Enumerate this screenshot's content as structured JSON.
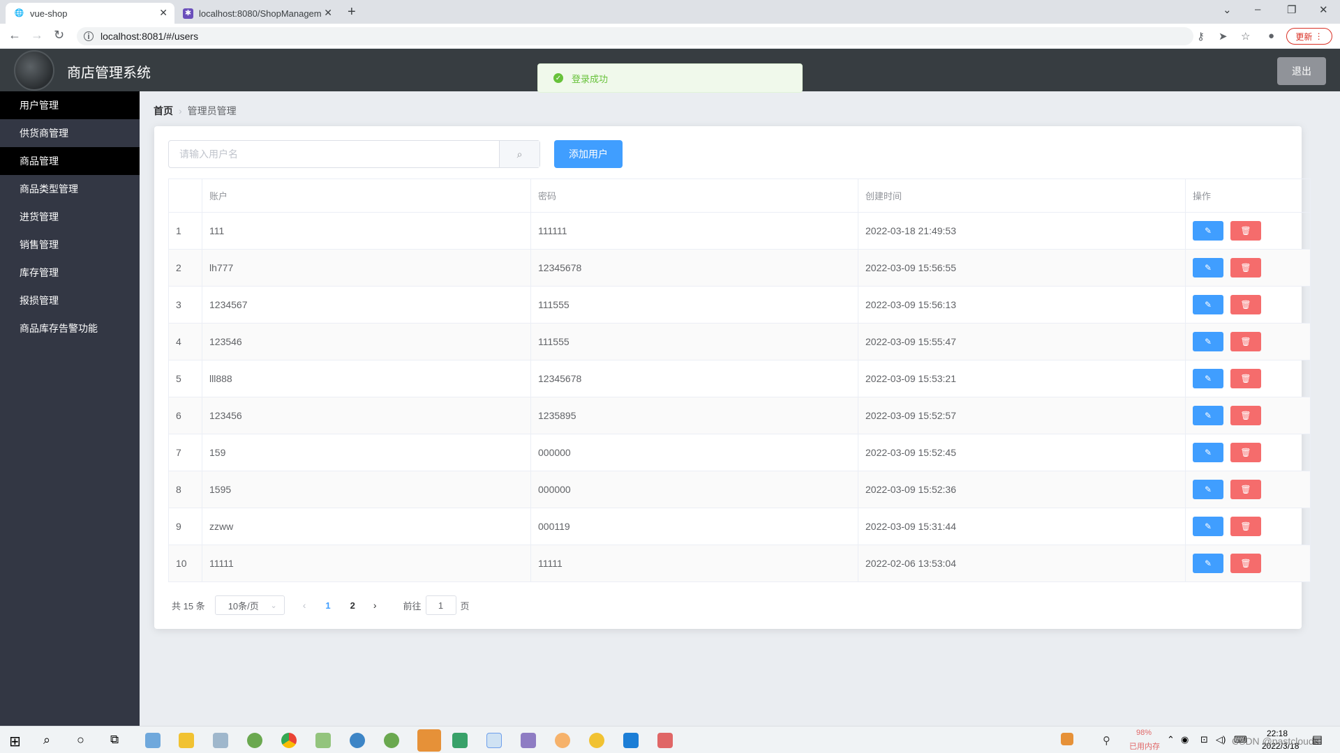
{
  "browser": {
    "tabs": [
      {
        "title": "vue-shop",
        "active": true
      },
      {
        "title": "localhost:8080/ShopManagem",
        "active": false
      }
    ],
    "url": "localhost:8081/#/users",
    "update_label": "更新"
  },
  "header": {
    "title": "商店管理系统",
    "logout_label": "退出"
  },
  "toast": {
    "message": "登录成功"
  },
  "sidebar": {
    "items": [
      {
        "label": "用户管理",
        "active": true
      },
      {
        "label": "供货商管理"
      },
      {
        "label": "商品管理",
        "hovered": true
      },
      {
        "label": "商品类型管理"
      },
      {
        "label": "进货管理"
      },
      {
        "label": "销售管理"
      },
      {
        "label": "库存管理"
      },
      {
        "label": "报损管理"
      },
      {
        "label": "商品库存告警功能"
      }
    ]
  },
  "breadcrumb": {
    "home": "首页",
    "current": "管理员管理"
  },
  "search": {
    "placeholder": "请输入用户名",
    "value": ""
  },
  "add_button_label": "添加用户",
  "table": {
    "columns": [
      "",
      "账户",
      "密码",
      "创建时间",
      "操作"
    ],
    "rows": [
      {
        "index": "1",
        "account": "111",
        "password": "111111",
        "created": "2022-03-18 21:49:53"
      },
      {
        "index": "2",
        "account": "lh777",
        "password": "12345678",
        "created": "2022-03-09 15:56:55"
      },
      {
        "index": "3",
        "account": "1234567",
        "password": "111555",
        "created": "2022-03-09 15:56:13"
      },
      {
        "index": "4",
        "account": "123546",
        "password": "111555",
        "created": "2022-03-09 15:55:47"
      },
      {
        "index": "5",
        "account": "lll888",
        "password": "12345678",
        "created": "2022-03-09 15:53:21"
      },
      {
        "index": "6",
        "account": "123456",
        "password": "1235895",
        "created": "2022-03-09 15:52:57"
      },
      {
        "index": "7",
        "account": "159",
        "password": "000000",
        "created": "2022-03-09 15:52:45"
      },
      {
        "index": "8",
        "account": "1595",
        "password": "000000",
        "created": "2022-03-09 15:52:36"
      },
      {
        "index": "9",
        "account": "zzww",
        "password": "000119",
        "created": "2022-03-09 15:31:44"
      },
      {
        "index": "10",
        "account": "11111",
        "password": "11111",
        "created": "2022-02-06 13:53:04"
      }
    ]
  },
  "pagination": {
    "total": "共 15 条",
    "page_size": "10条/页",
    "pages": [
      "1",
      "2"
    ],
    "current_page": "1",
    "goto_label": "前往",
    "goto_value": "1",
    "page_suffix": "页"
  },
  "taskbar": {
    "memory_percent": "98%",
    "memory_label": "已用内存",
    "time": "22:18",
    "date": "2022/3/18",
    "watermark": "CSDN @pastclouds"
  }
}
